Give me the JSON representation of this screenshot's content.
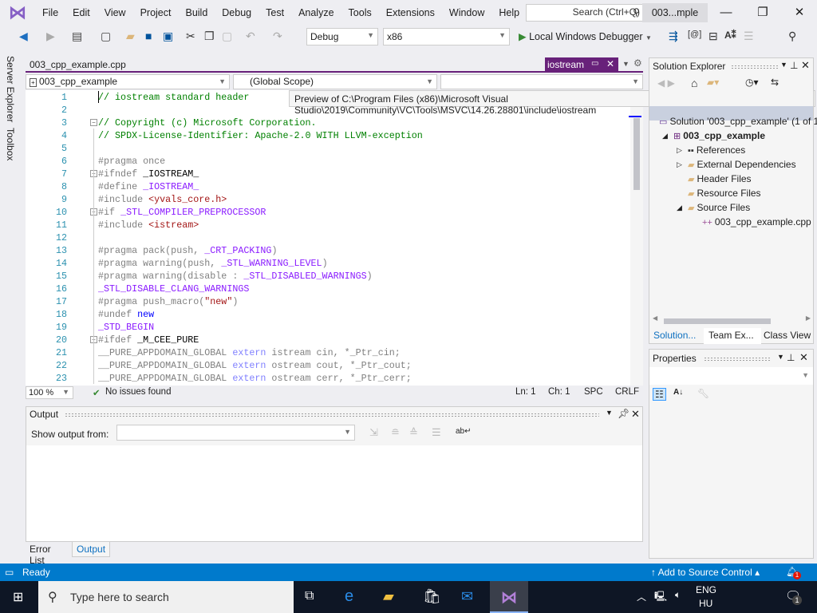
{
  "menu": {
    "items": [
      "File",
      "Edit",
      "View",
      "Project",
      "Build",
      "Debug",
      "Test",
      "Analyze",
      "Tools",
      "Extensions",
      "Window",
      "Help"
    ],
    "search_placeholder": "Search (Ctrl+Q)",
    "solution_short": "003...mple"
  },
  "toolbar": {
    "config": "Debug",
    "platform": "x86",
    "run_label": "Local Windows Debugger"
  },
  "side_tabs": [
    "Server Explorer",
    "Toolbox"
  ],
  "editor": {
    "doc_tab": "003_cpp_example.cpp",
    "preview_tab": "iostream",
    "nav": {
      "project": "003_cpp_example",
      "scope": "(Global Scope)",
      "member": ""
    },
    "tooltip": "Preview of C:\\Program Files (x86)\\Microsoft Visual Studio\\2019\\Community\\VC\\Tools\\MSVC\\14.26.28801\\include\\iostream",
    "lines": [
      [
        [
          "c",
          "// iostream standard header"
        ]
      ],
      [],
      [
        [
          "c",
          "// Copyright (c) Microsoft Corporation."
        ]
      ],
      [
        [
          "c",
          "// SPDX-License-Identifier: Apache-2.0 WITH LLVM-exception"
        ]
      ],
      [],
      [
        [
          "p",
          "#pragma once"
        ]
      ],
      [
        [
          "p",
          "#ifndef "
        ],
        [
          "x",
          "_IOSTREAM_"
        ]
      ],
      [
        [
          "p",
          "#define "
        ],
        [
          "m",
          "_IOSTREAM_"
        ]
      ],
      [
        [
          "p",
          "#include "
        ],
        [
          "s",
          "<yvals_core.h>"
        ]
      ],
      [
        [
          "p",
          "#if "
        ],
        [
          "m",
          "_STL_COMPILER_PREPROCESSOR"
        ]
      ],
      [
        [
          "p",
          "#include "
        ],
        [
          "s",
          "<istream>"
        ]
      ],
      [],
      [
        [
          "p",
          "#pragma pack(push, "
        ],
        [
          "m",
          "_CRT_PACKING"
        ],
        [
          "p",
          ")"
        ]
      ],
      [
        [
          "p",
          "#pragma warning(push, "
        ],
        [
          "m",
          "_STL_WARNING_LEVEL"
        ],
        [
          "p",
          ")"
        ]
      ],
      [
        [
          "p",
          "#pragma warning(disable : "
        ],
        [
          "m",
          "_STL_DISABLED_WARNINGS"
        ],
        [
          "p",
          ")"
        ]
      ],
      [
        [
          "m",
          "_STL_DISABLE_CLANG_WARNINGS"
        ]
      ],
      [
        [
          "p",
          "#pragma push_macro("
        ],
        [
          "s",
          "\"new\""
        ],
        [
          "p",
          ")"
        ]
      ],
      [
        [
          "p",
          "#undef "
        ],
        [
          "k",
          "new"
        ]
      ],
      [
        [
          "m",
          "_STD_BEGIN"
        ]
      ],
      [
        [
          "p",
          "#ifdef "
        ],
        [
          "x",
          "_M_CEE_PURE"
        ]
      ],
      [
        [
          "g",
          "__PURE_APPDOMAIN_GLOBAL "
        ],
        [
          "e",
          "extern"
        ],
        [
          "g",
          " istream cin, *_Ptr_cin;"
        ]
      ],
      [
        [
          "g",
          "__PURE_APPDOMAIN_GLOBAL "
        ],
        [
          "e",
          "extern"
        ],
        [
          "g",
          " ostream cout, *_Ptr_cout;"
        ]
      ],
      [
        [
          "g",
          "__PURE_APPDOMAIN_GLOBAL "
        ],
        [
          "e",
          "extern"
        ],
        [
          "g",
          " ostream cerr, *_Ptr_cerr;"
        ]
      ]
    ],
    "fold_lines": [
      3,
      7,
      10,
      20
    ],
    "status": {
      "zoom": "100 %",
      "issues": "No issues found",
      "ln": "Ln: 1",
      "ch": "Ch: 1",
      "spc": "SPC",
      "crlf": "CRLF"
    }
  },
  "output": {
    "title": "Output",
    "show_from_label": "Show output from:",
    "show_from_value": "",
    "tabs": [
      "Error List",
      "Output"
    ],
    "active_tab": "Output"
  },
  "solution_explorer": {
    "title": "Solution Explorer",
    "items": [
      {
        "label": "Solution '003_cpp_example' (1 of 1 project)",
        "icon": "solution-icon",
        "indent": 0
      },
      {
        "label": "003_cpp_example",
        "icon": "cpp-project-icon",
        "indent": 1,
        "bold": true,
        "expanded": true
      },
      {
        "label": "References",
        "icon": "references-icon",
        "indent": 2,
        "collapsed": true
      },
      {
        "label": "External Dependencies",
        "icon": "folder-icon",
        "indent": 2,
        "collapsed": true
      },
      {
        "label": "Header Files",
        "icon": "filter-folder-icon",
        "indent": 2
      },
      {
        "label": "Resource Files",
        "icon": "filter-folder-icon",
        "indent": 2
      },
      {
        "label": "Source Files",
        "icon": "filter-folder-icon",
        "indent": 2,
        "expanded": true
      },
      {
        "label": "003_cpp_example.cpp",
        "icon": "cpp-file-icon",
        "indent": 3
      }
    ],
    "tabs": [
      "Solution...",
      "Team Ex...",
      "Class View"
    ]
  },
  "properties": {
    "title": "Properties"
  },
  "statusbar": {
    "ready": "Ready",
    "source_control": "Add to Source Control",
    "notifications": "1"
  },
  "taskbar": {
    "search_placeholder": "Type here to search",
    "lang1": "ENG",
    "lang2": "HU",
    "action_center_count": "1"
  },
  "colors": {
    "accent": "#68217a",
    "status": "#007acc",
    "comment": "#008000",
    "macro": "#8a1bff",
    "string": "#a31515",
    "keyword": "#0000ff"
  }
}
